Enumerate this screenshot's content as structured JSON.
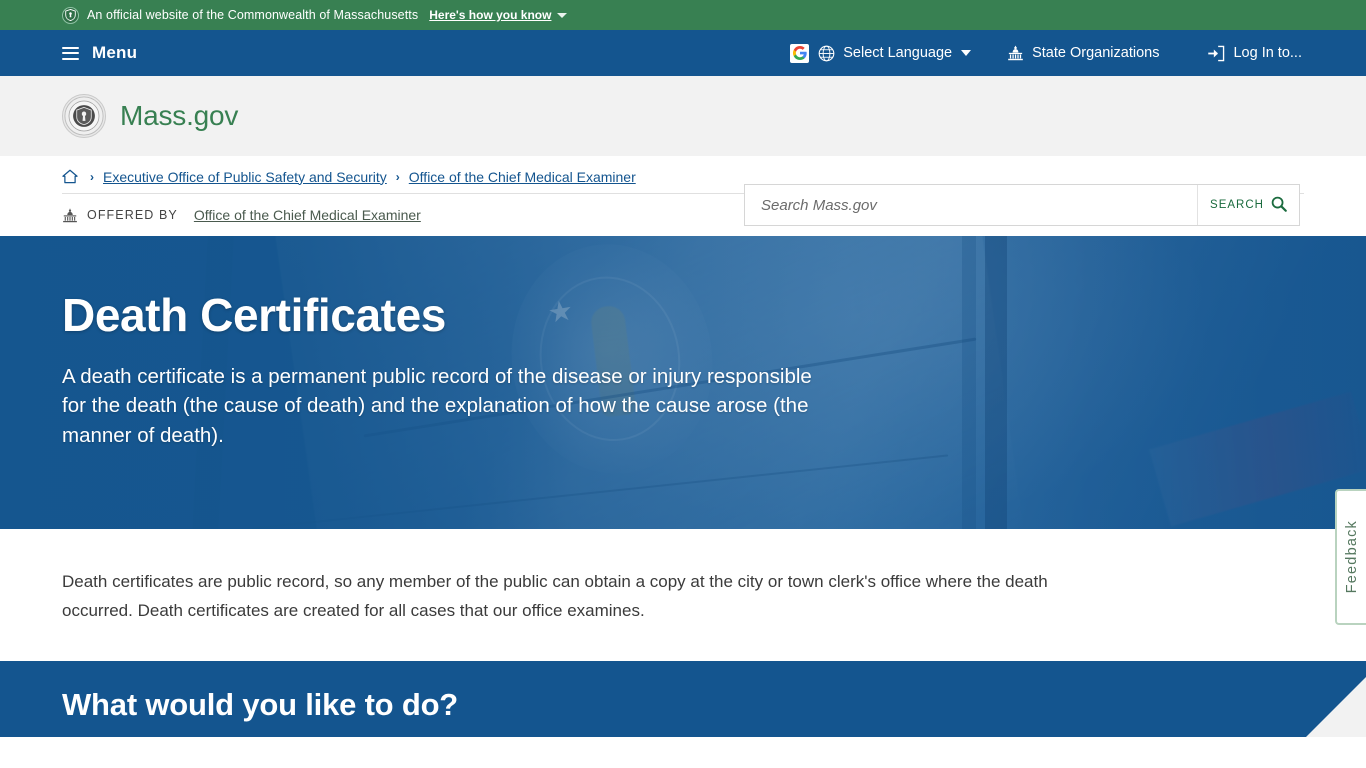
{
  "utility_bar": {
    "shield_icon": "shield-icon",
    "official_text": "An official website of the Commonwealth of Massachusetts",
    "how_you_know": "Here's how you know",
    "caret_icon": "chevron-down-icon"
  },
  "nav": {
    "menu_label": "Menu",
    "menu_icon": "hamburger-icon",
    "google_icon": "google-translate-icon",
    "google_letter": "G",
    "globe_icon": "globe-icon",
    "select_language": "Select Language",
    "language_caret": "chevron-down-icon",
    "capitol_icon": "capitol-building-icon",
    "state_organizations": "State Organizations",
    "login_icon": "login-arrow-icon",
    "login_label": "Log In to..."
  },
  "header": {
    "seal_icon": "massachusetts-state-seal",
    "brand": "Mass.gov"
  },
  "search": {
    "placeholder": "Search Mass.gov",
    "value": "",
    "button_label": "SEARCH",
    "button_icon": "magnifier-icon"
  },
  "breadcrumb": {
    "home_icon": "home-icon",
    "separator": "›",
    "items": [
      {
        "label": "Executive Office of Public Safety and Security"
      },
      {
        "label": "Office of the Chief Medical Examiner"
      }
    ]
  },
  "offered_by": {
    "icon": "capitol-building-icon",
    "label": "OFFERED BY",
    "org": "Office of the Chief Medical Examiner"
  },
  "hero": {
    "title": "Death Certificates",
    "subtitle": "A death certificate is a permanent public record of the disease or injury responsible for the death (the cause of death) and the explanation of how the cause arose (the manner of death).",
    "background_image": "massachusetts-state-flag-photo"
  },
  "main": {
    "paragraph": "Death certificates are public record, so any member of the public can obtain a copy at the city or town clerk's office where the death occurred. Death certificates are created for all cases that our office examines."
  },
  "cta": {
    "heading": "What would you like to do?"
  },
  "feedback": {
    "label": "Feedback"
  },
  "colors": {
    "official_green": "#388052",
    "brand_green": "#388052",
    "primary_blue": "#14558f",
    "hero_blue": "#1d5b94",
    "header_gray": "#f2f2f2",
    "link_blue": "#14558f",
    "feedback_border": "#b9d3bf",
    "feedback_text": "#55785f"
  }
}
